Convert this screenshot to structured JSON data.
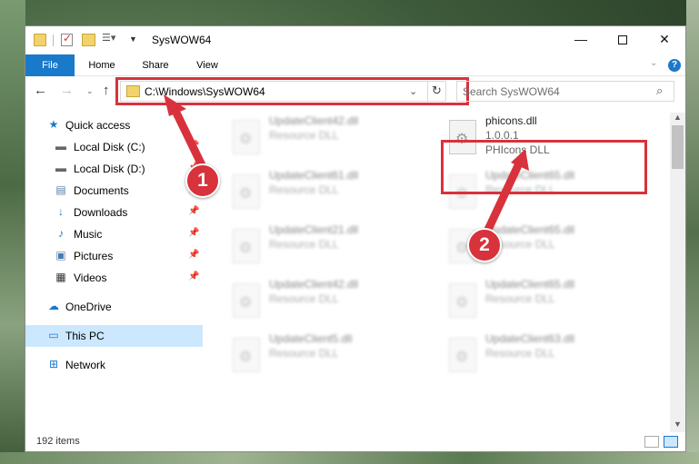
{
  "window": {
    "title": "SysWOW64",
    "controls": {
      "minimize": "—",
      "maximize": "",
      "close": "✕"
    }
  },
  "ribbon": {
    "tabs": [
      {
        "label": "File",
        "active": true
      },
      {
        "label": "Home"
      },
      {
        "label": "Share"
      },
      {
        "label": "View"
      }
    ],
    "help_label": "?"
  },
  "navigation": {
    "address": "C:\\Windows\\SysWOW64",
    "search_placeholder": "Search SysWOW64"
  },
  "sidebar": {
    "items": [
      {
        "label": "Quick access",
        "icon": "star-icon",
        "pinned": false
      },
      {
        "label": "Local Disk (C:)",
        "icon": "drive-icon",
        "pinned": true
      },
      {
        "label": "Local Disk (D:)",
        "icon": "drive-icon",
        "pinned": true
      },
      {
        "label": "Documents",
        "icon": "documents-icon",
        "pinned": true
      },
      {
        "label": "Downloads",
        "icon": "download-icon",
        "pinned": true
      },
      {
        "label": "Music",
        "icon": "music-icon",
        "pinned": true
      },
      {
        "label": "Pictures",
        "icon": "pictures-icon",
        "pinned": true
      },
      {
        "label": "Videos",
        "icon": "videos-icon",
        "pinned": true
      },
      {
        "label": "OneDrive",
        "icon": "cloud-icon",
        "pinned": false
      },
      {
        "label": "This PC",
        "icon": "computer-icon",
        "selected": true
      },
      {
        "label": "Network",
        "icon": "network-icon",
        "pinned": false
      }
    ]
  },
  "files": {
    "left_column": [
      {
        "name": "UpdateClient42.dll",
        "type": "Resource DLL"
      },
      {
        "name": "UpdateClient61.dll",
        "type": "Resource DLL"
      },
      {
        "name": "UpdateClient21.dll",
        "type": "Resource DLL"
      },
      {
        "name": "UpdateClient42.dll",
        "type": "Resource DLL"
      },
      {
        "name": "UpdateClient5.dll",
        "type": "Resource DLL"
      }
    ],
    "right_column": [
      {
        "name": "UpdateClient65.dll",
        "type": "Resource DLL"
      },
      {
        "name": "UpdateClient65.dll",
        "type": "Resource DLL"
      },
      {
        "name": "UpdateClient65.dll",
        "type": "Resource DLL"
      },
      {
        "name": "UpdateClient63.dll",
        "type": "Resource DLL"
      }
    ],
    "focus": {
      "name": "phicons.dll",
      "version": "1.0.0.1",
      "type": "PHIcons DLL"
    }
  },
  "status": {
    "item_count": "192 items"
  },
  "callouts": {
    "step1": "1",
    "step2": "2"
  },
  "colors": {
    "accent": "#1979ca",
    "highlight": "#d8323c",
    "selected": "#cce8ff"
  }
}
